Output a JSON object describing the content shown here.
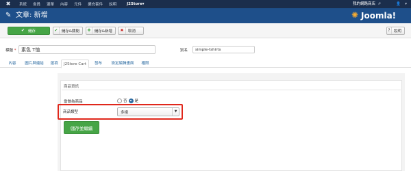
{
  "topbar": {
    "menu": [
      "系統",
      "會員",
      "選單",
      "內容",
      "元件",
      "擴充套件",
      "說明"
    ],
    "j2store": "J2Store",
    "site_link": "我的網路商店",
    "user_icon": "user-icon"
  },
  "header": {
    "title": "文章: 新增",
    "brand": "Joomla!"
  },
  "toolbar": {
    "save": "儲存",
    "save_close": "儲存&關閉",
    "save_new": "儲存&新增",
    "cancel": "取消",
    "help": "說明"
  },
  "form": {
    "title_label": "標題",
    "title_required": "*",
    "title_value": "素色 T恤",
    "alias_label": "別名",
    "alias_value": "simple-tshirts"
  },
  "tabs": [
    "內容",
    "圖片與連結",
    "選項",
    "J2Store Cart",
    "發布",
    "設定編輯畫面",
    "權限"
  ],
  "active_tab": "J2Store Cart",
  "product": {
    "section_title": "商品資訊",
    "variant_label": "當做為商品",
    "radio_no": "否",
    "radio_yes": "是",
    "selected": "是",
    "type_label": "商品類型",
    "type_value": "多樣",
    "save_continue": "儲存並繼續"
  },
  "colors": {
    "topbar": "#1b2e4c",
    "header": "#1e4f8a",
    "success": "#46a546",
    "highlight": "#e0271b"
  }
}
